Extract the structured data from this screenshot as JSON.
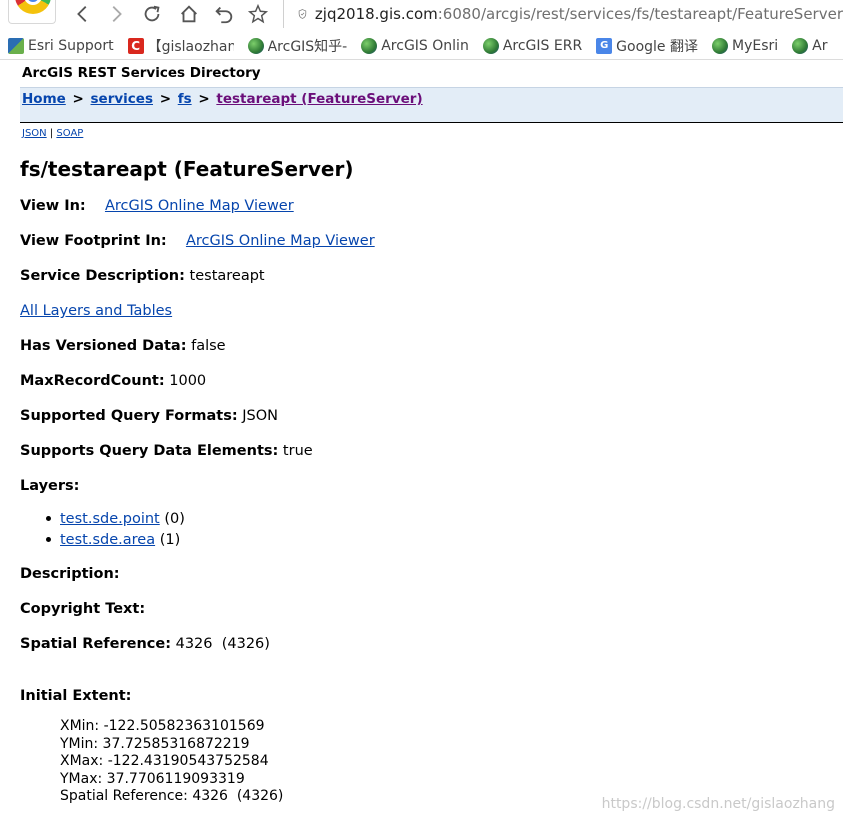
{
  "browser": {
    "url_host": "zjq2018.gis.com",
    "url_path": ":6080/arcgis/rest/services/fs/testareapt/FeatureServer",
    "bookmarks": [
      {
        "icon": "esri-icon",
        "label": "Esri Support"
      },
      {
        "icon": "csdn-icon",
        "label": "【gislaozhan"
      },
      {
        "icon": "globe-icon",
        "label": "ArcGIS知乎-"
      },
      {
        "icon": "globe-icon",
        "label": "ArcGIS Onlin"
      },
      {
        "icon": "globe-icon",
        "label": "ArcGIS ERR"
      },
      {
        "icon": "google-translate-icon",
        "label": "Google 翻译"
      },
      {
        "icon": "globe-icon",
        "label": "MyEsri"
      },
      {
        "icon": "globe-icon",
        "label": "Ar"
      }
    ]
  },
  "page": {
    "directory_title": "ArcGIS REST Services Directory",
    "breadcrumb": {
      "home": "Home",
      "services": "services",
      "fs": "fs",
      "current": "testareapt (FeatureServer)",
      "separator": ">"
    },
    "formats": {
      "json": "JSON",
      "divider": "|",
      "soap": "SOAP"
    },
    "heading": "fs/testareapt (FeatureServer)",
    "view_in": {
      "label": "View In:",
      "link": "ArcGIS Online Map Viewer"
    },
    "view_footprint": {
      "label": "View Footprint In:",
      "link": "ArcGIS Online Map Viewer"
    },
    "service_description": {
      "label": "Service Description:",
      "value": "testareapt"
    },
    "all_layers_link": "All Layers and Tables",
    "has_versioned_data": {
      "label": "Has Versioned Data:",
      "value": "false"
    },
    "max_record_count": {
      "label": "MaxRecordCount:",
      "value": "1000"
    },
    "query_formats": {
      "label": "Supported Query Formats:",
      "value": "JSON"
    },
    "query_data_elements": {
      "label": "Supports Query Data Elements:",
      "value": "true"
    },
    "layers_label": "Layers:",
    "layers": [
      {
        "name": "test.sde.point",
        "id": "(0)"
      },
      {
        "name": "test.sde.area",
        "id": "(1)"
      }
    ],
    "description_label": "Description:",
    "copyright_label": "Copyright Text:",
    "spatial_reference": {
      "label": "Spatial Reference:",
      "value": "4326  (4326)"
    },
    "initial_extent": {
      "label": "Initial Extent:",
      "xmin": "XMin: -122.50582363101569",
      "ymin": "YMin: 37.72585316872219",
      "xmax": "XMax: -122.43190543752584",
      "ymax": "YMax: 37.7706119093319",
      "spatial_reference": "Spatial Reference: 4326  (4326)"
    }
  },
  "watermark": "https://blog.csdn.net/gislaozhang"
}
